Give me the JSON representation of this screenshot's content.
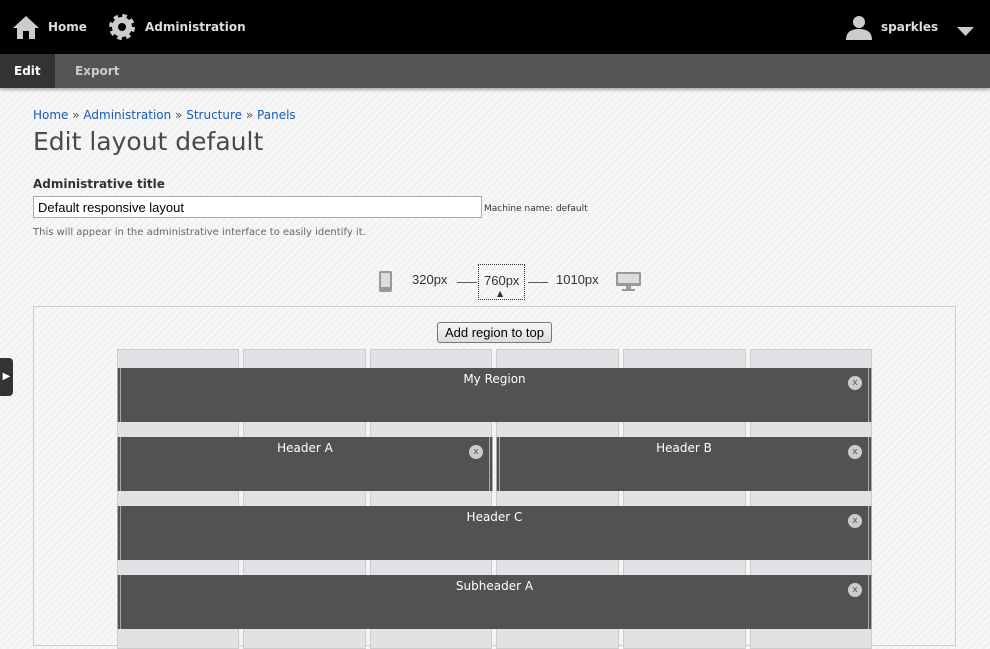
{
  "topbar": {
    "home": "Home",
    "admin": "Administration",
    "user": "sparkles"
  },
  "tabs": {
    "edit": "Edit",
    "export": "Export"
  },
  "breadcrumb": [
    "Home",
    "Administration",
    "Structure",
    "Panels"
  ],
  "page_title": "Edit layout default",
  "form": {
    "label": "Administrative title",
    "value": "Default responsive layout",
    "machine_name": "Machine name: default",
    "description": "This will appear in the administrative interface to easily identify it."
  },
  "breakpoints": {
    "small": "320px",
    "medium": "760px",
    "large": "1010px",
    "selected": "760px"
  },
  "add_region_label": "Add region to top",
  "regions": [
    {
      "name": "My Region",
      "close": "x"
    },
    {
      "name": "Header A",
      "close": "x"
    },
    {
      "name": "Header B",
      "close": "x"
    },
    {
      "name": "Header C",
      "close": "x"
    },
    {
      "name": "Subheader A",
      "close": "x"
    }
  ]
}
